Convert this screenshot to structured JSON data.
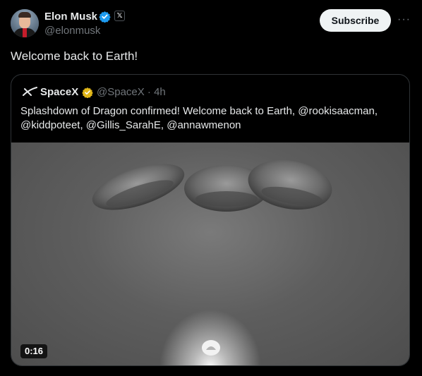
{
  "author": {
    "name": "Elon Musk",
    "handle": "@elonmusk",
    "affiliate_badge": "𝕏"
  },
  "subscribe_label": "Subscribe",
  "more_label": "···",
  "tweet_text": "Welcome back to Earth!",
  "quoted": {
    "name": "SpaceX",
    "meta": "@SpaceX · 4h",
    "text": "Splashdown of Dragon confirmed! Welcome back to Earth, @rookisaacman, @kiddpoteet, @Gillis_SarahE, @annawmenon",
    "video_time": "0:16"
  },
  "colors": {
    "verified_blue": "#1d9bf0",
    "org_gold": "#e2b719",
    "subscribe_bg": "#eff3f4"
  }
}
